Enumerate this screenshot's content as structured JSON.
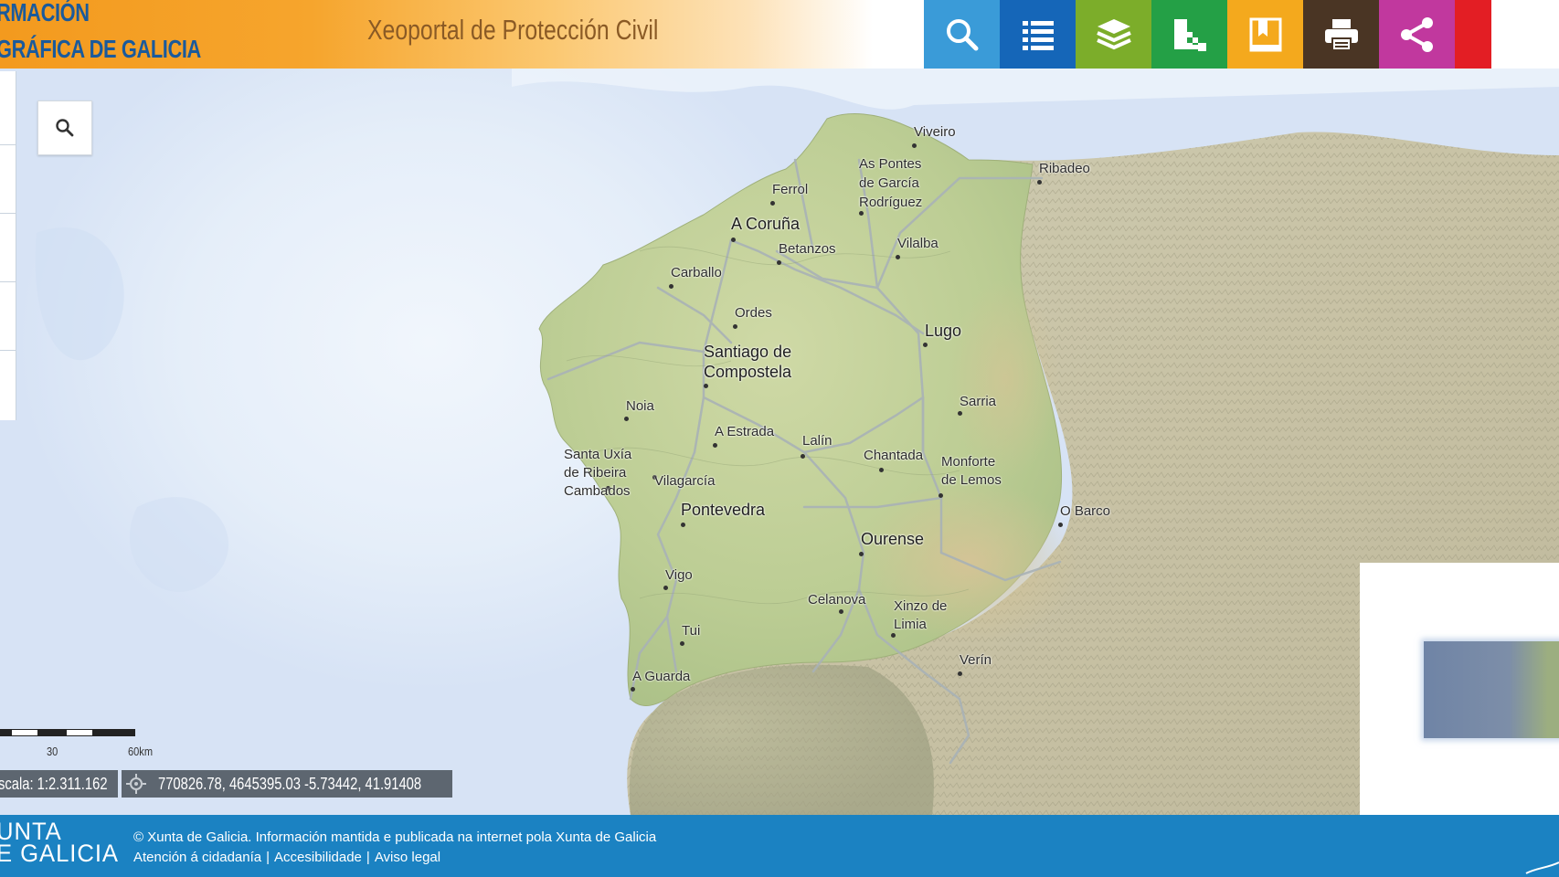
{
  "header": {
    "brand_line1": "RMACIÓN",
    "brand_line2": "GRÁFICA DE GALICIA",
    "portal_title": "Xeoportal de Protección Civil"
  },
  "toolbar": [
    {
      "icon": "search-icon",
      "color": "#3a9bd8"
    },
    {
      "icon": "map-marker-icon",
      "color": "#ea5a29"
    },
    {
      "icon": "list-icon",
      "color": "#1566b8"
    },
    {
      "icon": "layers-icon",
      "color": "#7cad2a"
    },
    {
      "icon": "grid-icon",
      "color": "#24a046"
    },
    {
      "icon": "bookmark-icon",
      "color": "#f4a91d"
    },
    {
      "icon": "print-icon",
      "color": "#4a3524"
    },
    {
      "icon": "share-icon",
      "color": "#c1389e"
    }
  ],
  "map": {
    "cities": {
      "viveiro": "Viveiro",
      "ribadeo": "Ribadeo",
      "as_pontes_1": "As Pontes",
      "as_pontes_2": "de García",
      "as_pontes_3": "Rodríguez",
      "ferrol": "Ferrol",
      "a_coruna": "A Coruña",
      "betanzos": "Betanzos",
      "vilalba": "Vilalba",
      "carballo": "Carballo",
      "ordes": "Ordes",
      "lugo": "Lugo",
      "santiago_1": "Santiago de",
      "santiago_2": "Compostela",
      "sarria": "Sarria",
      "noia": "Noia",
      "a_estrada": "A Estrada",
      "lalin": "Lalín",
      "chantada": "Chantada",
      "ribeira_1": "Santa Uxía",
      "ribeira_2": "de Ribeira",
      "cambados": "Cambados",
      "vilagarcia": "Vilagarcía",
      "monforte_1": "Monforte",
      "monforte_2": "de Lemos",
      "pontevedra": "Pontevedra",
      "o_barco": "O Barco",
      "ourense": "Ourense",
      "vigo": "Vigo",
      "celanova": "Celanova",
      "xinzo_1": "Xinzo de",
      "xinzo_2": "Limia",
      "tui": "Tui",
      "verin": "Verín",
      "a_guarda": "A Guarda"
    },
    "scale_label_1": "30",
    "scale_label_2": "60km",
    "scale_text": "scala: 1:2.311.162",
    "coords_text": "770826.78, 4645395.03   -5.73442, 41.91408"
  },
  "footer": {
    "xunta_line1": "UNTA",
    "xunta_line2": "E GALICIA",
    "copyright": "© Xunta de Galicia. Información mantida e publicada na internet pola Xunta de Galicia",
    "link_atencion": "Atención á cidadanía",
    "link_accesibilidade": "Accesibilidade",
    "link_aviso": "Aviso legal",
    "separator": "|"
  }
}
